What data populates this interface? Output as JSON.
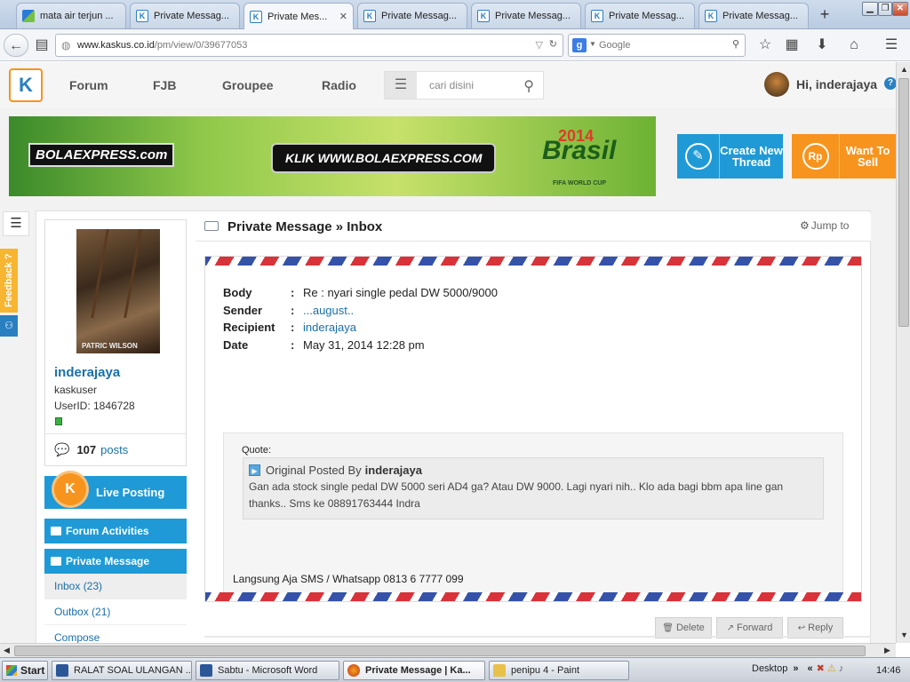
{
  "browser": {
    "tabs": [
      {
        "label": "mata air terjun ..."
      },
      {
        "label": "Private Messag..."
      },
      {
        "label": "Private Mes...",
        "active": true
      },
      {
        "label": "Private Messag..."
      },
      {
        "label": "Private Messag..."
      },
      {
        "label": "Private Messag..."
      },
      {
        "label": "Private Messag..."
      }
    ],
    "new_tab_symbol": "+",
    "url_host": "www.kaskus.co.id",
    "url_path": "/pm/view/0/39677053",
    "search_placeholder": "Google"
  },
  "site": {
    "nav": [
      "Forum",
      "FJB",
      "Groupee",
      "Radio"
    ],
    "search_placeholder": "cari disini",
    "greeting": "Hi, inderajaya",
    "help_symbol": "?",
    "banner": {
      "brand": "BOLAEXPRESS.com",
      "cta": "KLIK WWW.BOLAEXPRESS.COM",
      "country": "Brasil",
      "year": "2014",
      "tagline": "FIFA WORLD CUP"
    },
    "create_thread_label": "Create New Thread",
    "want_to_sell_label": "Want To Sell",
    "rp_symbol": "Rp",
    "feedback_label": "Feedback ?"
  },
  "user": {
    "photo_caption": "PATRIC WILSON",
    "username": "inderajaya",
    "role": "kaskuser",
    "user_id": "UserID: 1846728",
    "posts_count": "107",
    "posts_label": "posts"
  },
  "sidebar": {
    "live_posting": "Live Posting",
    "forum_activities": "Forum Activities",
    "private_message": "Private Message",
    "links": [
      {
        "label": "Inbox (23)",
        "active": true
      },
      {
        "label": "Outbox (21)"
      },
      {
        "label": "Compose"
      }
    ]
  },
  "message": {
    "header_title": "Private Message » Inbox",
    "jump_to": "Jump to",
    "fields": [
      {
        "key": "Body",
        "value": "Re : nyari single pedal DW 5000/9000",
        "link": false
      },
      {
        "key": "Sender",
        "value": "...august..",
        "link": true
      },
      {
        "key": "Recipient",
        "value": "inderajaya",
        "link": true
      },
      {
        "key": "Date",
        "value": "May 31, 2014 12:28 pm",
        "link": false
      }
    ],
    "quote_label": "Quote:",
    "quote_prefix": "Original Posted By",
    "quote_author": "inderajaya",
    "quote_text": "Gan ada stock single pedal DW 5000 seri AD4 ga? Atau DW 9000. Lagi nyari nih.. Klo ada bagi bbm apa line gan thanks.. Sms ke 08891763444 Indra",
    "signature": "Langsung Aja SMS / Whatsapp 0813 6 7777 099",
    "actions": {
      "delete": "Delete",
      "forward": "Forward",
      "reply": "Reply"
    }
  },
  "taskbar": {
    "start": "Start",
    "tasks": [
      {
        "label": "RALAT  SOAL ULANGAN ..."
      },
      {
        "label": "Sabtu - Microsoft Word"
      },
      {
        "label": "Private Message | Ka...",
        "active": true
      },
      {
        "label": "penipu 4 - Paint"
      }
    ],
    "desktop": "Desktop",
    "clock": "14:46"
  },
  "colors": {
    "kaskus_blue": "#1f9ad6",
    "kaskus_orange": "#f7941d",
    "link_blue": "#1a6fa8",
    "airmail_red": "#d8323a",
    "airmail_blue": "#3552a8"
  }
}
